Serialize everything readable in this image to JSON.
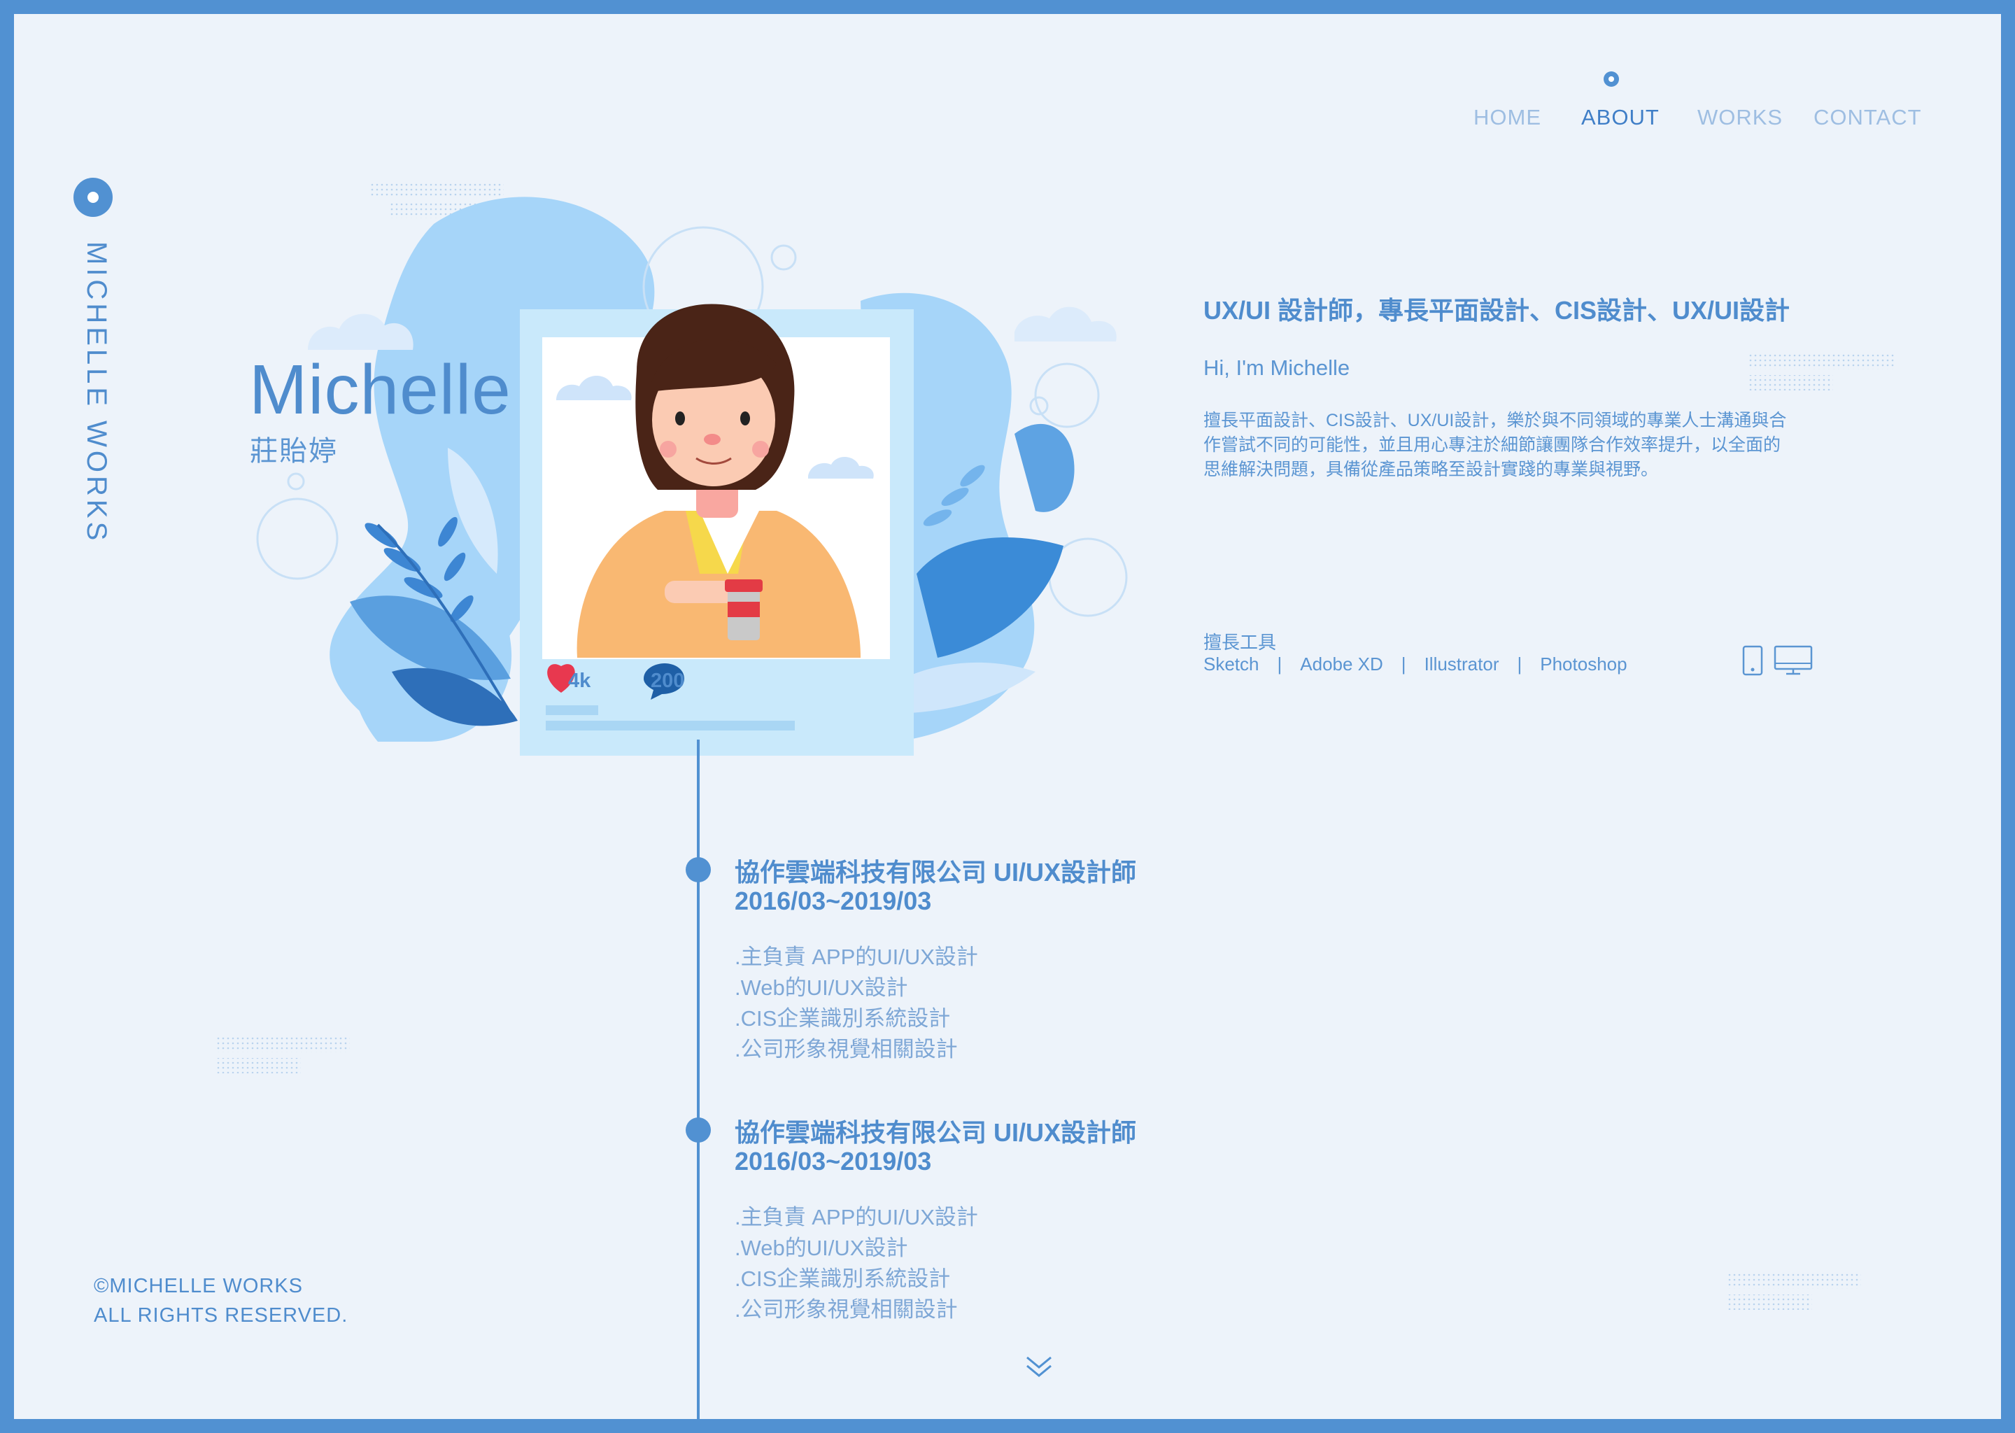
{
  "nav": {
    "items": [
      {
        "label": "HOME",
        "active": false
      },
      {
        "label": "ABOUT",
        "active": true
      },
      {
        "label": "WORKS",
        "active": false
      },
      {
        "label": "CONTACT",
        "active": false
      }
    ]
  },
  "sidebar": {
    "site_title": "MICHELLE WORKS"
  },
  "hero": {
    "name": "Michelle",
    "name_cn": "莊貽婷",
    "post_likes": "4k",
    "post_comments": "200"
  },
  "about": {
    "heading": "UX/UI 設計師，專長平面設計、CIS設計、UX/UI設計",
    "greeting": "Hi, I'm Michelle",
    "description_lines": [
      "擅長平面設計、CIS設計、UX/UI設計，樂於與不同領域的專業人士溝通與合",
      "作嘗試不同的可能性，並且用心專注於細節讓團隊合作效率提升，以全面的",
      "思維解決問題，具備從產品策略至設計實踐的專業與視野。"
    ],
    "tools_label": "擅長工具",
    "tools": [
      "Sketch",
      "Adobe XD",
      "Illustrator",
      "Photoshop"
    ],
    "separator": "|"
  },
  "experience": [
    {
      "title": "協作雲端科技有限公司 UI/UX設計師",
      "dates": "2016/03~2019/03",
      "items": [
        ".主負責 APP的UI/UX設計",
        ".Web的UI/UX設計",
        ".CIS企業識別系統設計",
        ".公司形象視覺相關設計"
      ]
    },
    {
      "title": "協作雲端科技有限公司 UI/UX設計師",
      "dates": "2016/03~2019/03",
      "items": [
        ".主負責 APP的UI/UX設計",
        ".Web的UI/UX設計",
        ".CIS企業識別系統設計",
        ".公司形象視覺相關設計"
      ]
    }
  ],
  "footer": {
    "copyright_line1": "©MICHELLE WORKS",
    "copyright_line2": "ALL RIGHTS RESERVED."
  },
  "icons": {
    "nav_active_marker": "dot-icon",
    "sidebar_marker": "dot-icon",
    "like": "heart-icon",
    "comment": "chat-bubble-icon",
    "devices": [
      "mobile-icon",
      "desktop-icon"
    ],
    "scroll": "double-chevron-down-icon"
  },
  "colors": {
    "frame": "#5191d2",
    "background": "#edf3fa",
    "primary_text": "#4f8ccd",
    "muted_text": "#9ebee2",
    "like_red": "#e8384f",
    "comment_blue": "#1e5fa6"
  }
}
